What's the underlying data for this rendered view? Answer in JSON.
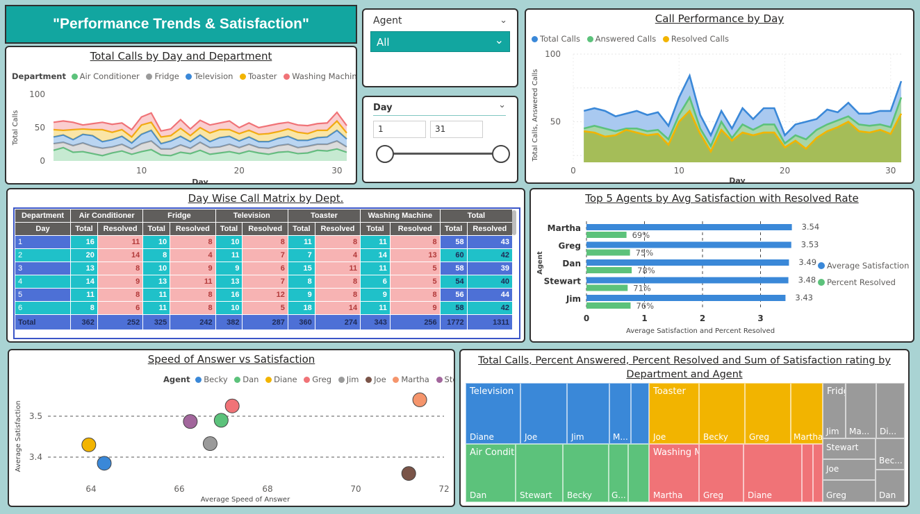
{
  "header": {
    "title": "\"Performance Trends & Satisfaction\""
  },
  "agent_slicer": {
    "label": "Agent",
    "value": "All"
  },
  "day_slicer": {
    "label": "Day",
    "min": "1",
    "max": "31"
  },
  "colors": {
    "air_conditioner": "#5cc27b",
    "fridge": "#9a9a9a",
    "television": "#3a88d8",
    "toaster": "#f2b400",
    "washing_machine": "#f07377",
    "total_calls": "#3a88d8",
    "answered": "#5cc27b",
    "resolved": "#f2b400"
  },
  "chart_data": [
    {
      "id": "total_calls_by_day",
      "type": "area",
      "title": "Total Calls by Day and Department",
      "xlabel": "Day",
      "ylabel": "Total Calls",
      "legend_title": "Department",
      "ylim": [
        0,
        100
      ],
      "yticks": [
        "0",
        "50",
        "100"
      ],
      "xticks": [
        "10",
        "20",
        "30"
      ],
      "x": [
        1,
        2,
        3,
        4,
        5,
        6,
        7,
        8,
        9,
        10,
        11,
        12,
        13,
        14,
        15,
        16,
        17,
        18,
        19,
        20,
        21,
        22,
        23,
        24,
        25,
        26,
        27,
        28,
        29,
        30,
        31
      ],
      "series": [
        {
          "name": "Air Conditioner",
          "values": [
            16,
            20,
            13,
            14,
            11,
            8,
            12,
            15,
            10,
            14,
            17,
            9,
            8,
            13,
            11,
            16,
            10,
            12,
            14,
            11,
            15,
            12,
            10,
            13,
            14,
            11,
            12,
            16,
            15,
            18,
            13
          ]
        },
        {
          "name": "Fridge",
          "values": [
            10,
            8,
            10,
            13,
            11,
            11,
            9,
            10,
            8,
            12,
            13,
            9,
            10,
            11,
            8,
            12,
            10,
            9,
            11,
            9,
            10,
            8,
            9,
            10,
            11,
            9,
            10,
            9,
            10,
            12,
            8
          ]
        },
        {
          "name": "Television",
          "values": [
            10,
            11,
            9,
            13,
            16,
            10,
            11,
            12,
            9,
            14,
            16,
            8,
            12,
            13,
            10,
            11,
            9,
            14,
            12,
            10,
            11,
            9,
            10,
            11,
            12,
            11,
            9,
            10,
            11,
            16,
            12
          ]
        },
        {
          "name": "Toaster",
          "values": [
            11,
            7,
            15,
            8,
            9,
            18,
            11,
            10,
            9,
            14,
            12,
            10,
            8,
            12,
            9,
            11,
            13,
            12,
            10,
            11,
            10,
            11,
            12,
            10,
            11,
            12,
            10,
            11,
            10,
            14,
            9
          ]
        },
        {
          "name": "Washing Machine",
          "values": [
            11,
            14,
            11,
            6,
            9,
            11,
            12,
            10,
            11,
            12,
            14,
            9,
            10,
            13,
            10,
            11,
            12,
            10,
            13,
            9,
            11,
            10,
            12,
            12,
            10,
            11,
            12,
            10,
            11,
            13,
            11
          ]
        }
      ]
    },
    {
      "id": "call_performance_by_day",
      "type": "area",
      "title": "Call Performance by Day",
      "xlabel": "Day",
      "ylabel": "Total Calls, Answered Calls",
      "ylim": [
        20,
        100
      ],
      "yticks": [
        "50",
        "100"
      ],
      "xticks": [
        "0",
        "10",
        "20",
        "30"
      ],
      "x": [
        1,
        2,
        3,
        4,
        5,
        6,
        7,
        8,
        9,
        10,
        11,
        12,
        13,
        14,
        15,
        16,
        17,
        18,
        19,
        20,
        21,
        22,
        23,
        24,
        25,
        26,
        27,
        28,
        29,
        30,
        31
      ],
      "series": [
        {
          "name": "Total Calls",
          "values": [
            58,
            60,
            58,
            54,
            56,
            58,
            55,
            57,
            47,
            68,
            84,
            55,
            40,
            58,
            45,
            60,
            52,
            60,
            60,
            40,
            48,
            50,
            52,
            59,
            57,
            64,
            56,
            56,
            58,
            58,
            80
          ]
        },
        {
          "name": "Answered Calls",
          "values": [
            45,
            47,
            45,
            43,
            45,
            45,
            43,
            44,
            37,
            55,
            68,
            45,
            32,
            50,
            38,
            48,
            44,
            48,
            48,
            34,
            40,
            37,
            44,
            48,
            51,
            54,
            48,
            47,
            48,
            46,
            68
          ]
        },
        {
          "name": "Resolved Calls",
          "values": [
            43,
            42,
            39,
            40,
            44,
            42,
            40,
            41,
            33,
            50,
            58,
            41,
            28,
            44,
            36,
            42,
            40,
            42,
            42,
            31,
            36,
            30,
            38,
            43,
            46,
            50,
            43,
            42,
            44,
            41,
            56
          ]
        }
      ]
    },
    {
      "id": "top5_agents",
      "type": "bar",
      "title": "Top 5 Agents by Avg Satisfaction with Resolved Rate",
      "xlabel": "Average Satisfaction and Percent Resolved",
      "ylabel": "Agent",
      "categories": [
        "Martha",
        "Greg",
        "Dan",
        "Stewart",
        "Jim"
      ],
      "xlim": [
        0,
        4
      ],
      "xticks": [
        "0",
        "1",
        "2",
        "3"
      ],
      "series": [
        {
          "name": "Average Satisfaction",
          "values": [
            3.54,
            3.53,
            3.49,
            3.48,
            3.43
          ],
          "labels": [
            "3.54",
            "3.53",
            "3.49",
            "3.48",
            "3.43"
          ]
        },
        {
          "name": "Percent Resolved",
          "values": [
            0.69,
            0.75,
            0.78,
            0.71,
            0.76
          ],
          "labels": [
            "69%",
            "75%",
            "78%",
            "71%",
            "76%"
          ]
        }
      ]
    },
    {
      "id": "speed_vs_satisfaction",
      "type": "scatter",
      "title": "Speed of Answer vs Satisfaction",
      "xlabel": "Average Speed of Answer",
      "ylabel": "Average Satisfaction",
      "legend_title": "Agent",
      "xlim": [
        63.5,
        72
      ],
      "ylim": [
        3.35,
        3.6
      ],
      "xticks": [
        "64",
        "66",
        "68",
        "70",
        "72"
      ],
      "yticks": [
        "3.4",
        "3.5"
      ],
      "series": [
        {
          "name": "Becky",
          "x": 64.3,
          "y": 3.385
        },
        {
          "name": "Dan",
          "x": 66.95,
          "y": 3.49
        },
        {
          "name": "Diane",
          "x": 63.95,
          "y": 3.43
        },
        {
          "name": "Greg",
          "x": 67.2,
          "y": 3.525
        },
        {
          "name": "Jim",
          "x": 66.7,
          "y": 3.433
        },
        {
          "name": "Joe",
          "x": 71.2,
          "y": 3.36
        },
        {
          "name": "Martha",
          "x": 71.45,
          "y": 3.54
        },
        {
          "name": "Stewart",
          "x": 66.25,
          "y": 3.487
        }
      ],
      "series_colors": [
        "#3a88d8",
        "#5cc27b",
        "#f2b400",
        "#f07377",
        "#9a9a9a",
        "#7a5448",
        "#f5956c",
        "#a2669c"
      ]
    }
  ],
  "matrix": {
    "title": "Day Wise Call Matrix by Dept.",
    "corner_top": "Department",
    "corner_bottom": "Day",
    "departments": [
      "Air Conditioner",
      "Fridge",
      "Television",
      "Toaster",
      "Washing Machine",
      "Total"
    ],
    "subheaders": [
      "Total",
      "Resolved"
    ],
    "rows": [
      {
        "day": "1",
        "values": [
          "16",
          "11",
          "10",
          "8",
          "10",
          "8",
          "11",
          "8",
          "11",
          "8",
          "58",
          "43"
        ]
      },
      {
        "day": "2",
        "values": [
          "20",
          "14",
          "8",
          "4",
          "11",
          "7",
          "7",
          "4",
          "14",
          "13",
          "60",
          "42"
        ]
      },
      {
        "day": "3",
        "values": [
          "13",
          "8",
          "10",
          "9",
          "9",
          "6",
          "15",
          "11",
          "11",
          "5",
          "58",
          "39"
        ]
      },
      {
        "day": "4",
        "values": [
          "14",
          "9",
          "13",
          "11",
          "13",
          "7",
          "8",
          "8",
          "6",
          "5",
          "54",
          "40"
        ]
      },
      {
        "day": "5",
        "values": [
          "11",
          "8",
          "11",
          "8",
          "16",
          "12",
          "9",
          "8",
          "9",
          "8",
          "56",
          "44"
        ]
      },
      {
        "day": "6",
        "values": [
          "8",
          "6",
          "11",
          "8",
          "10",
          "5",
          "18",
          "14",
          "11",
          "9",
          "58",
          "42"
        ]
      }
    ],
    "total": {
      "label": "Total",
      "values": [
        "362",
        "252",
        "325",
        "242",
        "382",
        "287",
        "360",
        "274",
        "343",
        "256",
        "1772",
        "1311"
      ]
    }
  },
  "treemap": {
    "title_line1": "Total Calls, Percent Answered, Percent Resolved and Sum of Satisfaction rating by",
    "title_line2": "Department and Agent",
    "groups": [
      {
        "name": "Television",
        "agents": [
          "Diane",
          "Joe",
          "Jim",
          "M..."
        ]
      },
      {
        "name": "Toaster",
        "agents": [
          "Joe",
          "Becky",
          "Greg",
          "Martha"
        ]
      },
      {
        "name": "Fridge",
        "agents": [
          "Jim",
          "Ma...",
          "Di...",
          "Stewart",
          "Joe",
          "Bec...",
          "Greg",
          "Dan"
        ]
      },
      {
        "name": "Air Conditioner",
        "agents": [
          "Dan",
          "Stewart",
          "Becky",
          "G..."
        ]
      },
      {
        "name": "Washing Machine",
        "agents": [
          "Martha",
          "Greg",
          "Diane"
        ]
      }
    ]
  }
}
